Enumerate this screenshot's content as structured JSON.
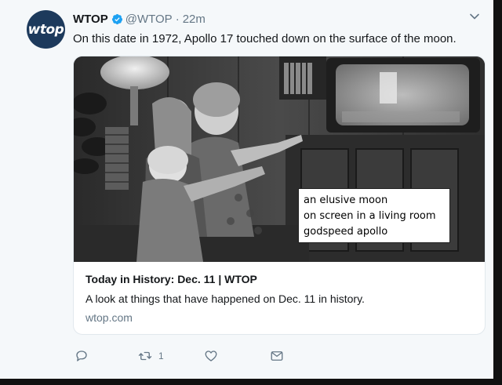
{
  "tweet": {
    "avatar_text": "wtop",
    "name": "WTOP",
    "handle": "@WTOP",
    "separator": "·",
    "time": "22m",
    "text": "On this date in 1972, Apollo 17 touched down on the surface of the moon."
  },
  "card": {
    "title": "Today in History: Dec. 11 | WTOP",
    "description": "A look at things that have happened on Dec. 11 in history.",
    "domain": "wtop.com"
  },
  "caption": {
    "lines": [
      "an elusive moon",
      "on screen in a living room",
      "godspeed apollo"
    ]
  },
  "actions": {
    "reply_icon": "reply-icon",
    "retweet_icon": "retweet-icon",
    "retweet_count": "1",
    "like_icon": "heart-icon",
    "dm_icon": "envelope-icon"
  },
  "colors": {
    "background": "#f5f8fa",
    "verified": "#1da1f2",
    "secondary_text": "#657786",
    "avatar": "#1d3a5c",
    "avatar_bar": "#f2b430"
  }
}
